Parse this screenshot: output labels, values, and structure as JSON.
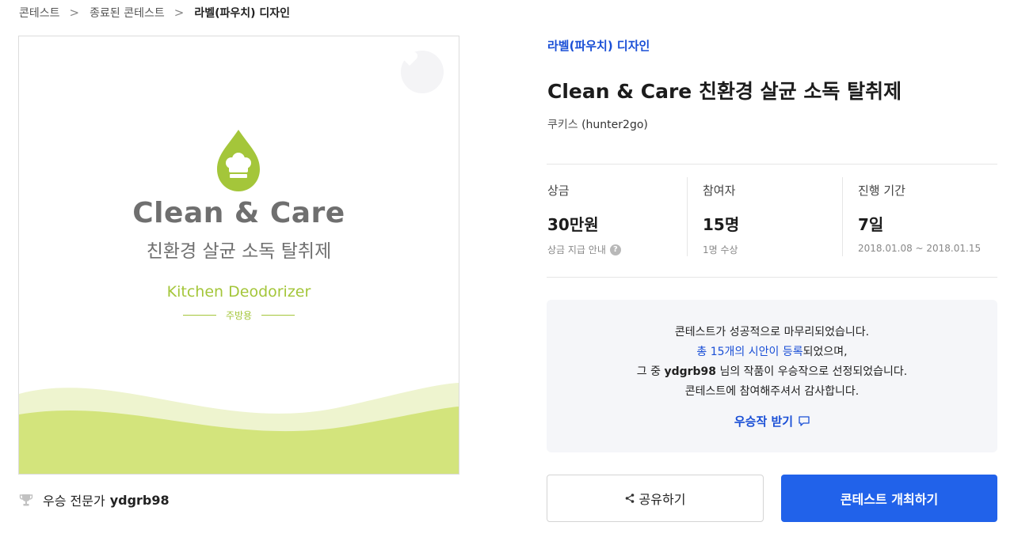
{
  "breadcrumb": {
    "items": [
      "콘테스트",
      "종료된 콘테스트",
      "라벨(파우치) 디자인"
    ],
    "separator": ">"
  },
  "artwork": {
    "title": "Clean & Care",
    "subtitle": "친환경 살균 소독 탈취제",
    "tagline": "Kitchen Deodorizer",
    "usage": "주방용",
    "accent_color": "#a4c63a",
    "wave_color": "#d3e47c"
  },
  "winner": {
    "label": "우승 전문가",
    "name": "ydgrb98"
  },
  "contest": {
    "category": "라벨(파우치) 디자인",
    "title": "Clean & Care 친환경 살균 소독 탈취제",
    "owner_name": "쿠키스",
    "owner_id": "(hunter2go)"
  },
  "stats": {
    "prize": {
      "label": "상금",
      "value": "30만원",
      "sub": "상금 지급 안내"
    },
    "participants": {
      "label": "참여자",
      "value": "15명",
      "sub": "1명 수상"
    },
    "duration": {
      "label": "진행 기간",
      "value": "7일",
      "sub": "2018.01.08 ~ 2018.01.15"
    }
  },
  "notice": {
    "line1": "콘테스트가 성공적으로 마무리되었습니다.",
    "line2_link": "총 15개의 시안이 등록",
    "line2_rest": "되었으며,",
    "line3_pre": "그 중 ",
    "line3_name": "ydgrb98",
    "line3_post": " 님의 작품이 우승작으로 선정되었습니다.",
    "line4": "콘테스트에 참여해주셔서 감사합니다.",
    "download_label": "우승작 받기"
  },
  "actions": {
    "share_label": "공유하기",
    "host_label": "콘테스트 개최하기"
  },
  "colors": {
    "primary": "#2162ea",
    "link": "#1a4fd6"
  }
}
